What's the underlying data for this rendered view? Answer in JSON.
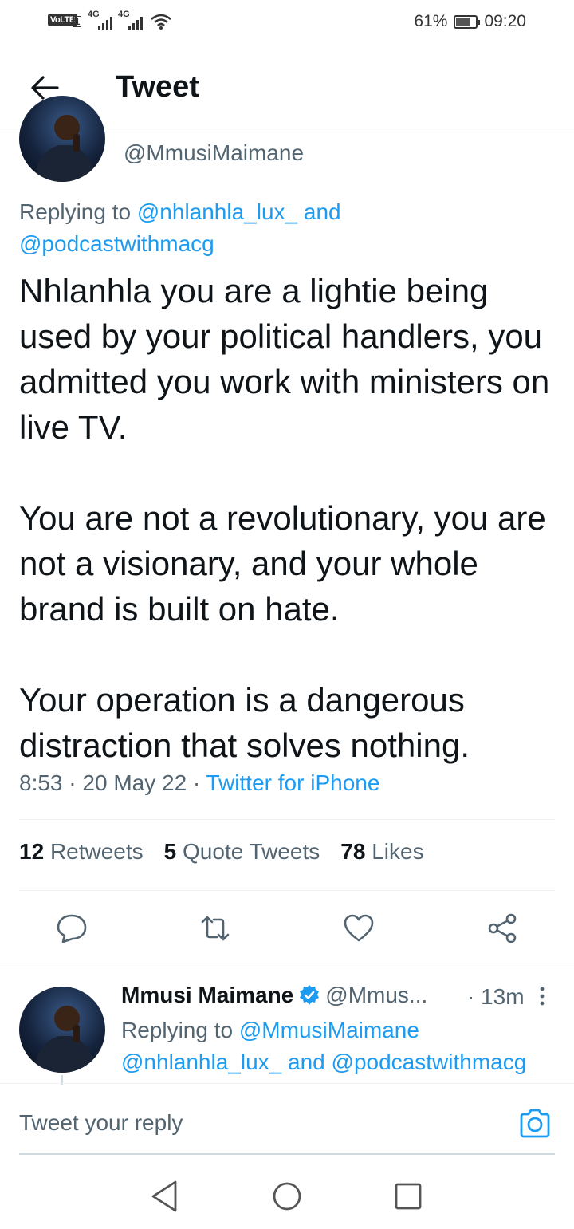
{
  "status_bar": {
    "volte": "VoLTE",
    "sim": "1",
    "network1": "4G",
    "network2": "4G",
    "battery": "61%",
    "time": "09:20"
  },
  "header": {
    "title": "Tweet"
  },
  "tweet": {
    "handle": "@MmusiMaimane",
    "replying_prefix": "Replying to",
    "replying_to_1": "@nhlanhla_lux_",
    "replying_and": "and",
    "replying_to_2": "@podcastwithmacg",
    "text": "Nhlanhla you are a lightie being used by your political handlers, you admitted you work with ministers on live TV.\n\nYou are not a revolutionary, you are not a visionary, and your whole brand is built on hate.\n\nYour operation is a dangerous distraction that solves nothing.",
    "time": "8:53",
    "date": "20 May 22",
    "source": "Twitter for iPhone",
    "separator": "·"
  },
  "stats": {
    "retweets_count": "12",
    "retweets_label": "Retweets",
    "quotes_count": "5",
    "quotes_label": "Quote Tweets",
    "likes_count": "78",
    "likes_label": "Likes"
  },
  "actions": [
    "reply-icon",
    "retweet-icon",
    "like-icon",
    "share-icon"
  ],
  "reply": {
    "name": "Mmusi Maimane",
    "handle": "@Mmus...",
    "time": "· 13m",
    "replying_prefix": "Replying to",
    "replying_to_1": "@MmusiMaimane",
    "replying_to_2": "@nhlanhla_lux_",
    "replying_and": "and",
    "replying_to_3": "@podcastwithmacg"
  },
  "compose": {
    "placeholder": "Tweet your reply"
  },
  "colors": {
    "link": "#1d9bf0",
    "text": "#0f1419",
    "secondary": "#536471",
    "verified": "#1d9bf0"
  }
}
